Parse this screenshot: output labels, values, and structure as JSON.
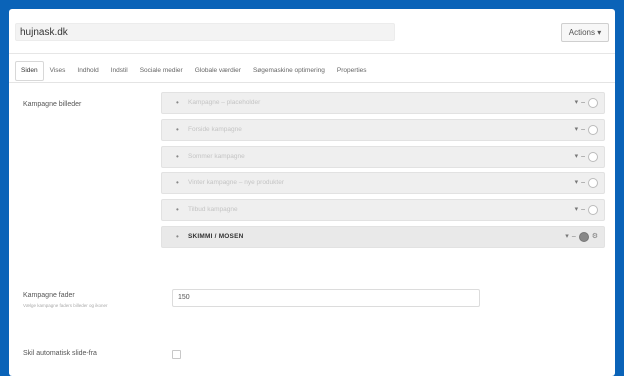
{
  "header": {
    "title_value": "hujnask.dk",
    "actions_label": "Actions ▾"
  },
  "tabs": [
    {
      "label": "Siden",
      "active": true
    },
    {
      "label": "Vises",
      "active": false
    },
    {
      "label": "Indhold",
      "active": false
    },
    {
      "label": "Indstil",
      "active": false
    },
    {
      "label": "Sociale medier",
      "active": false
    },
    {
      "label": "Globale værdier",
      "active": false
    },
    {
      "label": "Søgemaskine optimering",
      "active": false
    },
    {
      "label": "Properties",
      "active": false
    }
  ],
  "form": {
    "campaign_label": "Kampagne billeder",
    "campaigns": [
      {
        "name": "Kampagne – placeholder",
        "selected": false
      },
      {
        "name": "Forside kampagne",
        "selected": false
      },
      {
        "name": "Sommer kampagne",
        "selected": false
      },
      {
        "name": "Vinter kampagne – nye produkter",
        "selected": false
      },
      {
        "name": "Tilbud kampagne",
        "selected": false
      },
      {
        "name": "SKIMMI / MOSEN",
        "selected": true
      }
    ],
    "campaign_count_label": "Kampagne fader",
    "campaign_count_help": "Vælge kampagne faders billeder og ikoner",
    "campaign_count_value": "150",
    "autohide_label": "Skil automatisk slide-fra",
    "autohide_checked": false
  },
  "icons": {
    "bullet": "bullet-icon",
    "move_up": "arrow-up-icon",
    "move_down": "arrow-down-icon",
    "remove": "minus-icon",
    "toggle": "toggle-icon"
  }
}
